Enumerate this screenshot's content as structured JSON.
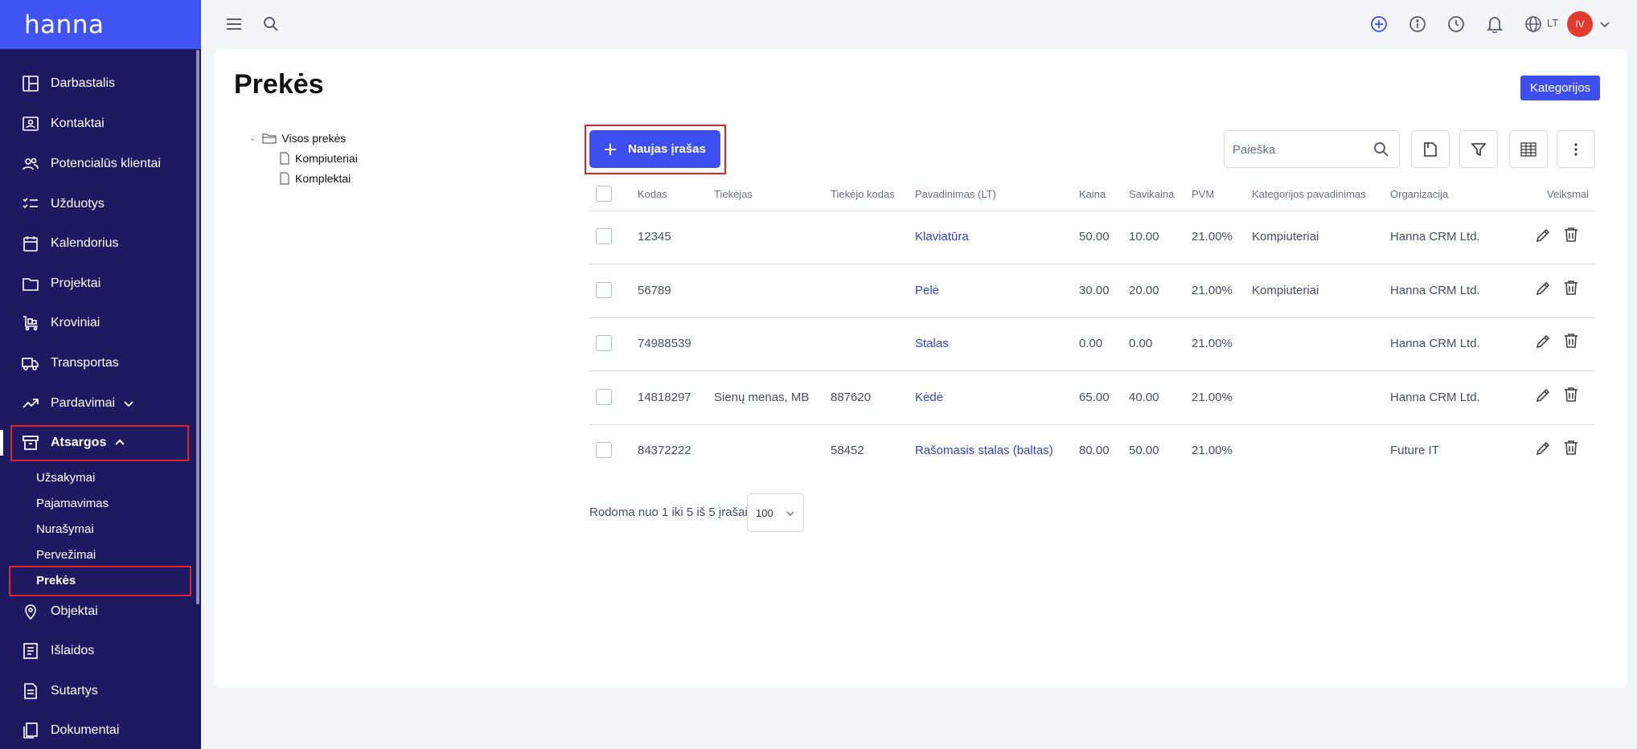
{
  "app": {
    "logo": "hanna"
  },
  "sidebar": {
    "items": [
      {
        "label": "Darbastalis",
        "icon": "dashboard-icon"
      },
      {
        "label": "Kontaktai",
        "icon": "contacts-icon"
      },
      {
        "label": "Potencialūs klientai",
        "icon": "leads-icon"
      },
      {
        "label": "Užduotys",
        "icon": "tasks-icon"
      },
      {
        "label": "Kalendorius",
        "icon": "calendar-icon"
      },
      {
        "label": "Projektai",
        "icon": "folder-icon"
      },
      {
        "label": "Kroviniai",
        "icon": "cargo-icon"
      },
      {
        "label": "Transportas",
        "icon": "truck-icon"
      },
      {
        "label": "Pardavimai",
        "icon": "trending-up-icon"
      },
      {
        "label": "Atsargos",
        "icon": "archive-icon"
      }
    ],
    "submenu": [
      "Užsakymai",
      "Pajamavimas",
      "Nurašymai",
      "Pervežimai",
      "Prekės"
    ],
    "items_after": [
      {
        "label": "Objektai",
        "icon": "location-pin-icon"
      },
      {
        "label": "Išlaidos",
        "icon": "receipt-icon"
      },
      {
        "label": "Sutartys",
        "icon": "document-icon"
      },
      {
        "label": "Dokumentai",
        "icon": "documents-icon"
      }
    ]
  },
  "topbar": {
    "language": "LT",
    "avatar_initials": "IV"
  },
  "page": {
    "title": "Prekės",
    "categories_button": "Kategorijos",
    "new_button": "Naujas įrašas",
    "search_placeholder": "Paieška"
  },
  "tree": {
    "root": "Visos prekės",
    "children": [
      "Kompiuteriai",
      "Komplektai"
    ]
  },
  "table": {
    "columns": [
      "Kodas",
      "Tiekėjas",
      "Tiekėjo kodas",
      "Pavadinimas (LT)",
      "Kaina",
      "Savikaina",
      "PVM",
      "Kategorijos pavadinimas",
      "Organizacija",
      "Veiksmai"
    ],
    "rows": [
      {
        "code": "12345",
        "supplier": "",
        "supplier_code": "",
        "name": "Klaviatūra",
        "price": "50.00",
        "cost": "10.00",
        "vat": "21.00%",
        "category": "Kompiuteriai",
        "org": "Hanna CRM Ltd."
      },
      {
        "code": "56789",
        "supplier": "",
        "supplier_code": "",
        "name": "Pelė",
        "price": "30.00",
        "cost": "20.00",
        "vat": "21.00%",
        "category": "Kompiuteriai",
        "org": "Hanna CRM Ltd."
      },
      {
        "code": "74988539",
        "supplier": "",
        "supplier_code": "",
        "name": "Stalas",
        "price": "0.00",
        "cost": "0.00",
        "vat": "21.00%",
        "category": "",
        "org": "Hanna CRM Ltd."
      },
      {
        "code": "14818297",
        "supplier": "Sienų menas, MB",
        "supplier_code": "887620",
        "name": "Kėdė",
        "price": "65.00",
        "cost": "40.00",
        "vat": "21.00%",
        "category": "",
        "org": "Hanna CRM Ltd."
      },
      {
        "code": "84372222",
        "supplier": "",
        "supplier_code": "58452",
        "name": "Rašomasis stalas (baltas)",
        "price": "80.00",
        "cost": "50.00",
        "vat": "21.00%",
        "category": "",
        "org": "Future IT"
      }
    ]
  },
  "footer": {
    "showing": "Rodoma nuo 1 iki 5 iš 5 įrašai",
    "page_size": "100"
  },
  "colors": {
    "sidebar": "#1d1a62",
    "accent": "#3d4ff0",
    "highlight": "#e0242c",
    "avatar": "#e33a2f"
  }
}
